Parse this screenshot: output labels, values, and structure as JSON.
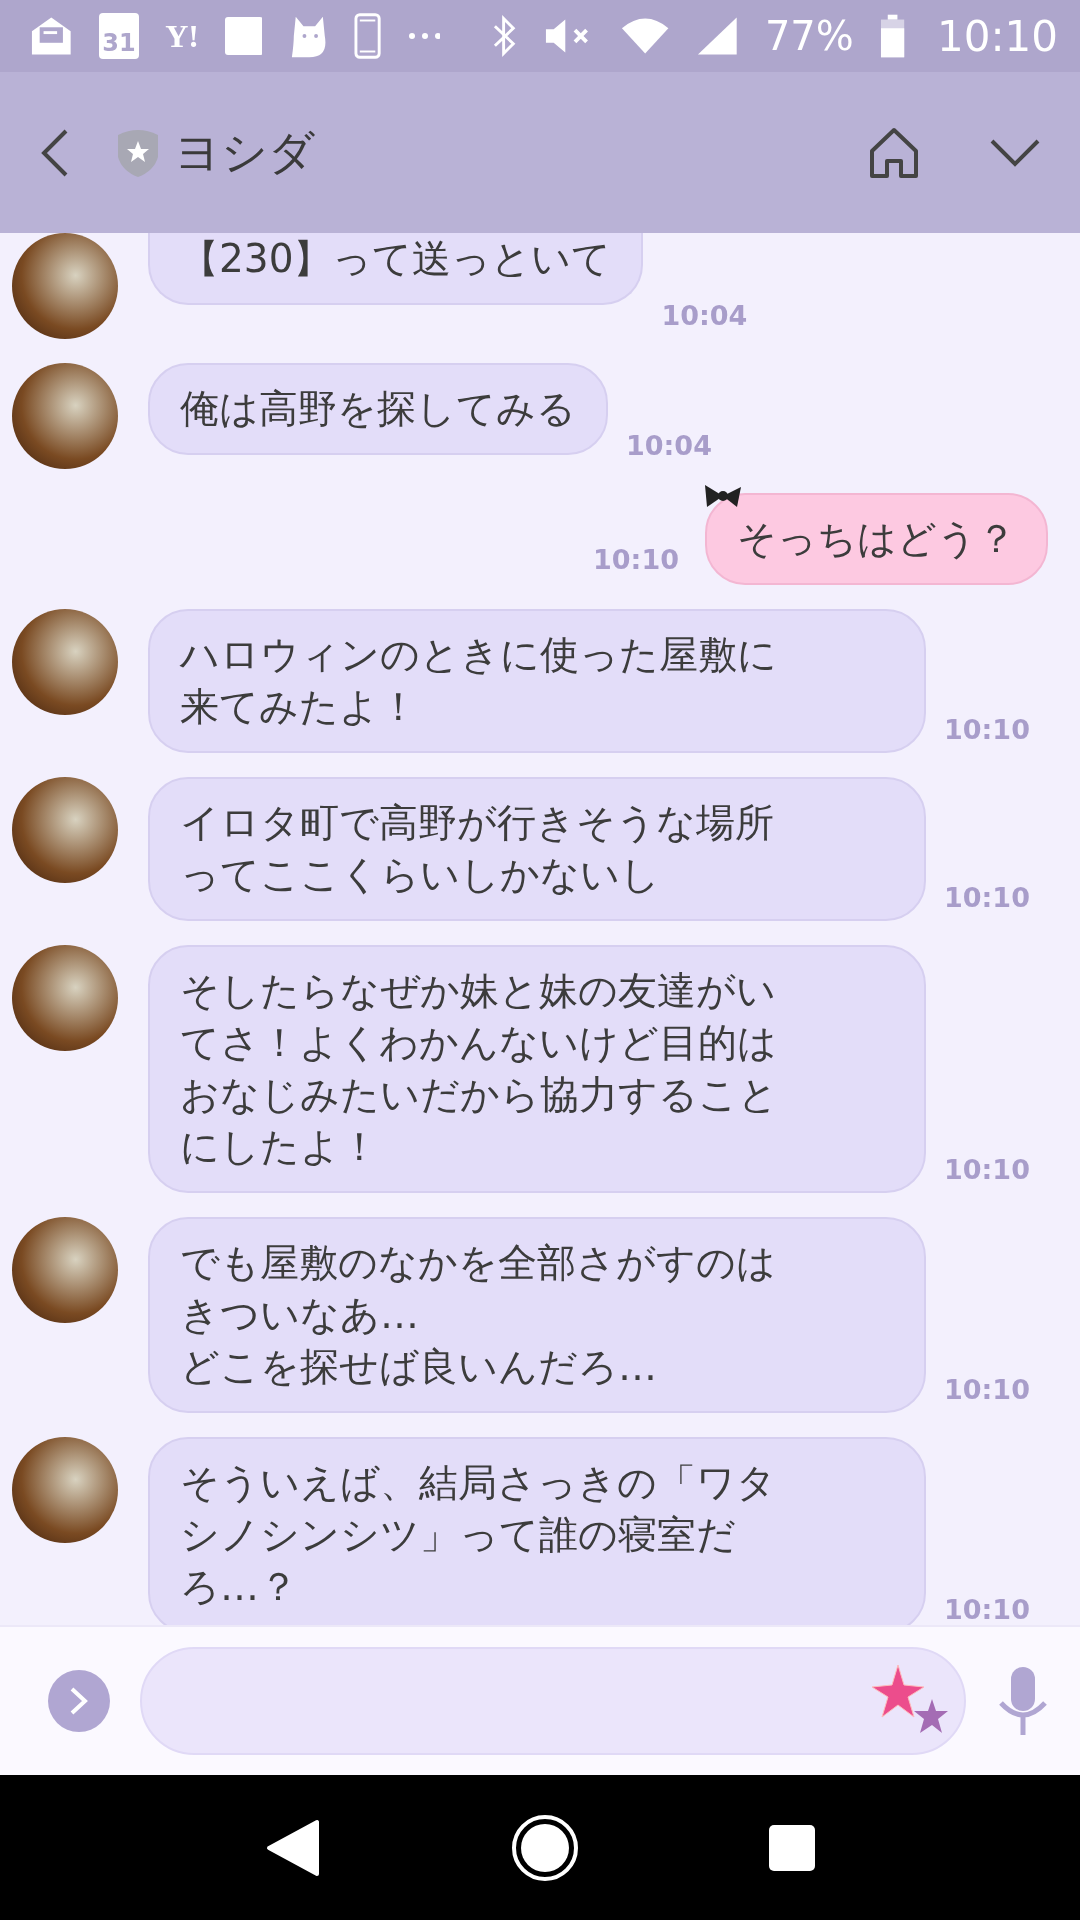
{
  "status_bar": {
    "calendar_day": "31",
    "yahoo_label": "Y!",
    "battery": "77%",
    "time": "10:10"
  },
  "header": {
    "title": "ヨシダ"
  },
  "messages": [
    {
      "kind": "received",
      "lines": [
        "【230】って送っといて"
      ],
      "time": "10:04"
    },
    {
      "kind": "received",
      "lines": [
        "俺は高野を探してみる"
      ],
      "time": "10:04"
    },
    {
      "kind": "sent",
      "lines": [
        "そっちはどう？"
      ],
      "time": "10:10"
    },
    {
      "kind": "received",
      "lines": [
        "ハロウィンのときに使った屋敷に",
        "来てみたよ！"
      ],
      "time": "10:10"
    },
    {
      "kind": "received",
      "lines": [
        "イロタ町で高野が行きそうな場所",
        "ってここくらいしかないし"
      ],
      "time": "10:10"
    },
    {
      "kind": "received",
      "lines": [
        "そしたらなぜか妹と妹の友達がい",
        "てさ！よくわかんないけど目的は",
        "おなじみたいだから協力すること",
        "にしたよ！"
      ],
      "time": "10:10"
    },
    {
      "kind": "received",
      "lines": [
        "でも屋敷のなかを全部さがすのは",
        "きついなあ…",
        "どこを探せば良いんだろ…"
      ],
      "time": "10:10"
    },
    {
      "kind": "received",
      "lines": [
        "そういえば、結局さっきの「ワタ",
        "シノシンシツ」って誰の寝室だ",
        "ろ…？"
      ],
      "time": "10:10"
    }
  ]
}
